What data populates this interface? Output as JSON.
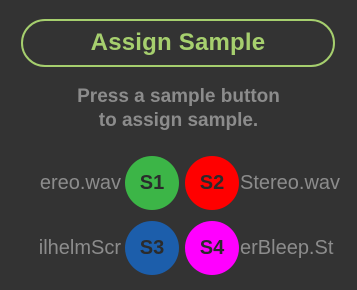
{
  "title": "Assign Sample",
  "instructions": {
    "line1": "Press a sample button",
    "line2": "to assign sample."
  },
  "samples": [
    {
      "slot": "S1",
      "name": "ereo.wav",
      "color": "#3cb547"
    },
    {
      "slot": "S2",
      "name": "Stereo.wav",
      "color": "#ff0000"
    },
    {
      "slot": "S3",
      "name": "ilhelmScr",
      "color": "#1c5eab"
    },
    {
      "slot": "S4",
      "name": "erBleep.St",
      "color": "#ff00ff"
    }
  ],
  "colors": {
    "background": "#333333",
    "accent": "#a6cf6e",
    "text_muted": "#8c8c8c"
  }
}
